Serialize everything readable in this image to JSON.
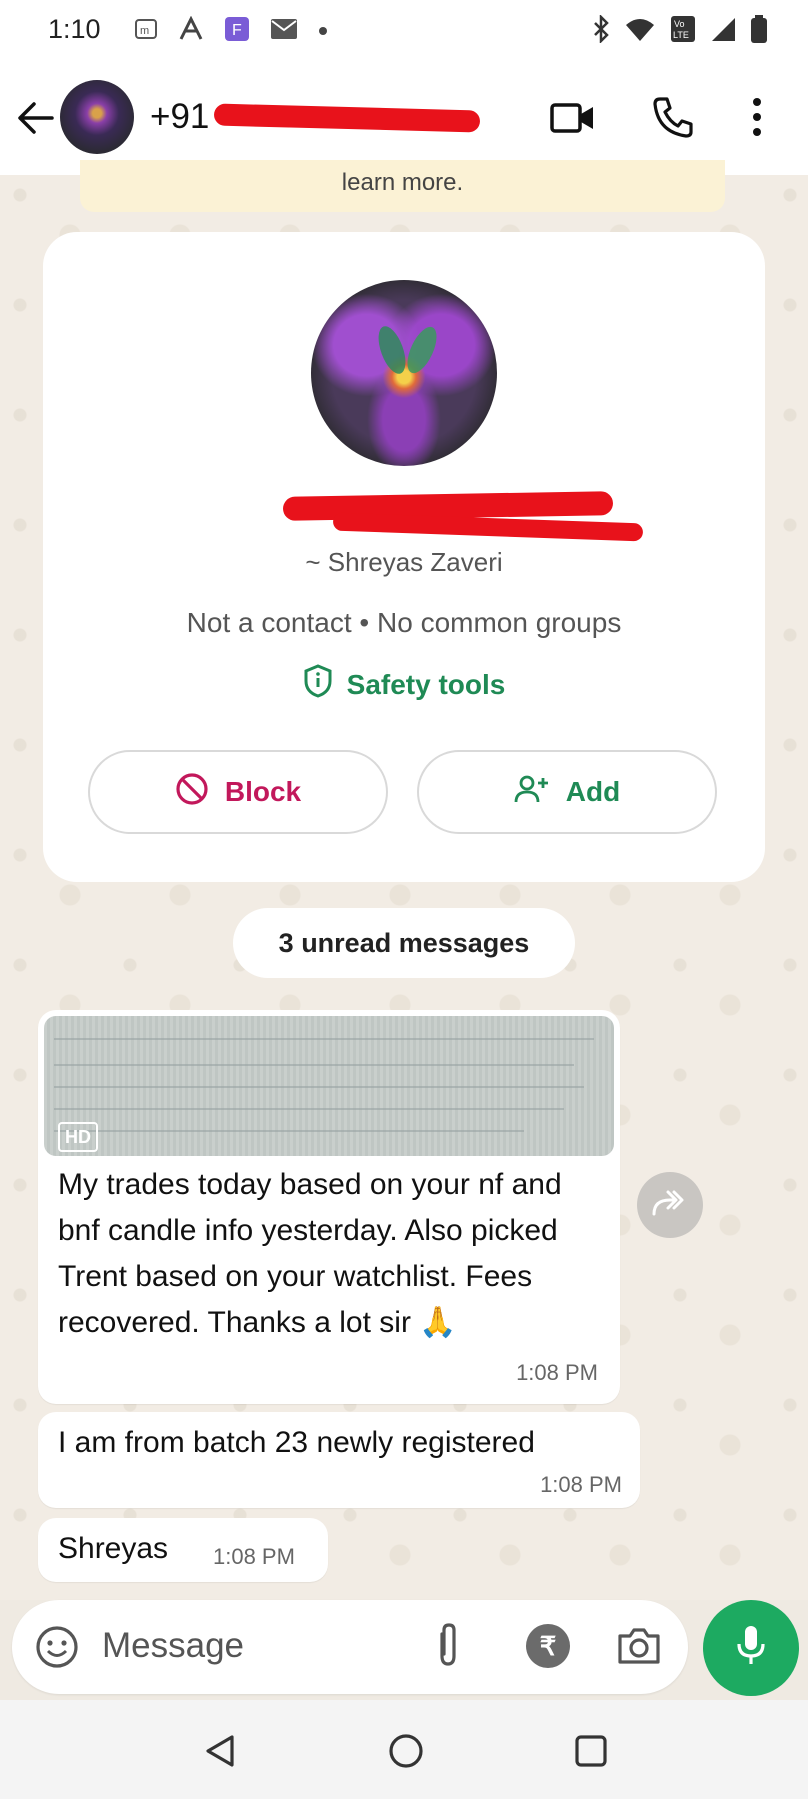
{
  "status_bar": {
    "time": "1:10"
  },
  "header": {
    "title": "+91"
  },
  "notice": {
    "text": "learn more."
  },
  "contact_card": {
    "phone": "+91",
    "profile_name": "~ Shreyas Zaveri",
    "subtitle": "Not a contact • No common groups",
    "safety_tools_label": "Safety tools",
    "block_label": "Block",
    "add_label": "Add"
  },
  "unread": {
    "label": "3 unread messages"
  },
  "messages": [
    {
      "badge": "HD",
      "text": "My trades today based on your nf and bnf candle info yesterday. Also picked Trent based on your watchlist. Fees recovered. Thanks a lot sir 🙏",
      "time": "1:08 PM"
    },
    {
      "text": "I am from batch 23 newly registered",
      "time": "1:08 PM"
    },
    {
      "text": "Shreyas",
      "time": "1:08 PM"
    }
  ],
  "composer": {
    "placeholder": "Message",
    "rupee_symbol": "₹"
  },
  "colors": {
    "accent_green": "#1daa61",
    "block_red": "#c2185b",
    "chat_background": "#efeae2"
  }
}
